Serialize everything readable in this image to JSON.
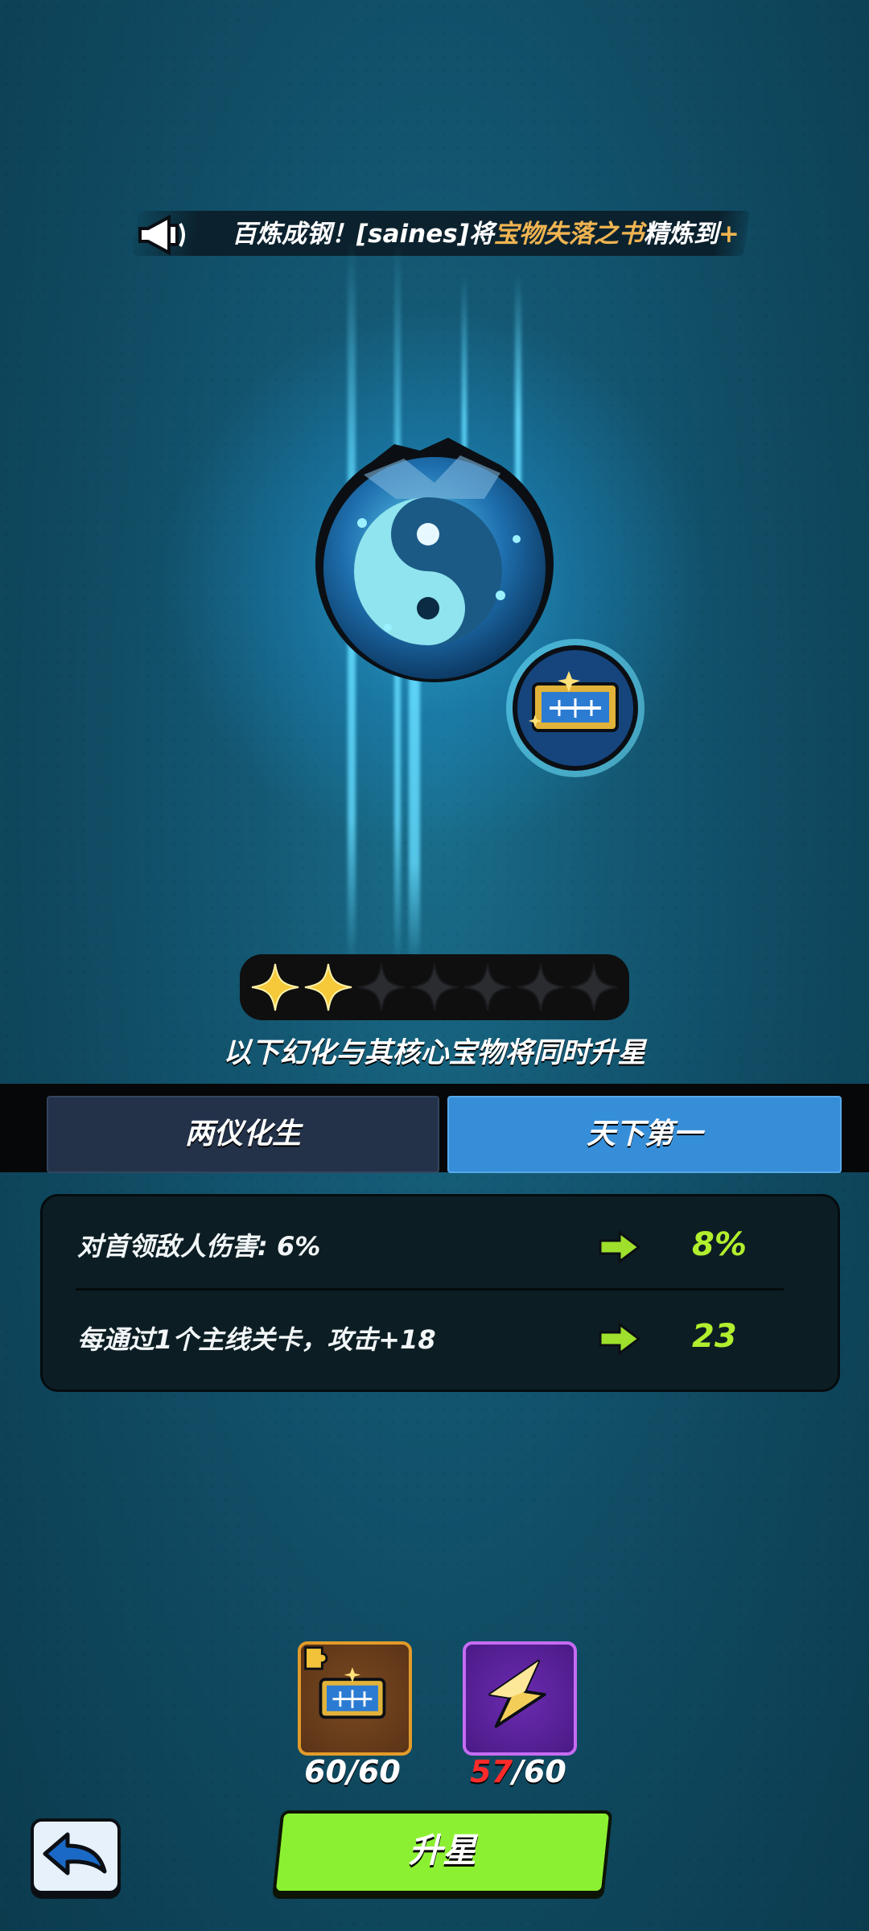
{
  "broadcast": {
    "prefix": "百炼成钢！[saines]将",
    "item": "宝物失落之书",
    "suffix": "精炼到",
    "tail": "+"
  },
  "treasure": {
    "icon": "yin-yang-orb-icon",
    "badge_icon": "tianxia-diyi-plaque-icon"
  },
  "stars": {
    "filled": 2,
    "total": 7
  },
  "caption": "以下幻化与其核心宝物将同时升星",
  "tabs": [
    {
      "label": "两仪化生",
      "active": false
    },
    {
      "label": "天下第一",
      "active": true
    }
  ],
  "stats": [
    {
      "label": "对首领敌人伤害: 6%",
      "new_value": "8%"
    },
    {
      "label": "每通过1个主线关卡，攻击+18",
      "new_value": "23"
    }
  ],
  "costs": [
    {
      "icon": "plaque-scroll-icon",
      "owned": "60",
      "sep": "/",
      "required": "60"
    },
    {
      "icon": "star-shard-icon",
      "owned": "57",
      "sep": "/",
      "required": "60"
    }
  ],
  "buttons": {
    "upgrade": "升星",
    "back_icon": "back-arrow-icon"
  },
  "colors": {
    "accent_green": "#8cf032",
    "value_green": "#b2ef2e",
    "gold_text": "#f0b451",
    "tab_active": "#378ed8",
    "shortage_red": "#ff2b2b"
  }
}
